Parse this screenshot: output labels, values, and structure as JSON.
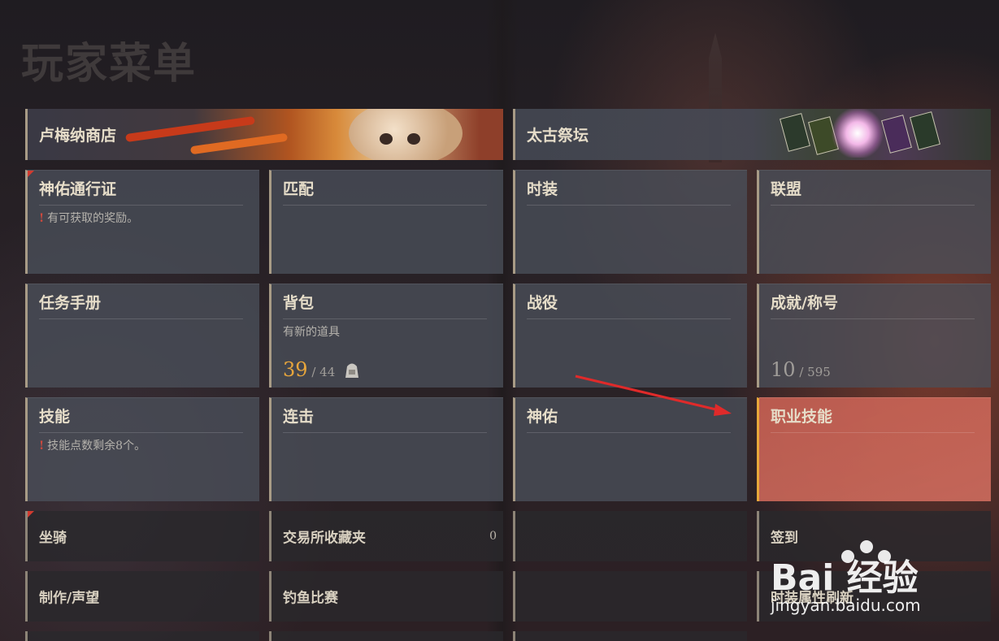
{
  "page_title": "玩家菜单",
  "banners": {
    "lumina_shop": "卢梅纳商店",
    "ancient_altar": "太古祭坛"
  },
  "tiles": {
    "pass": {
      "label": "神佑通行证",
      "note": "有可获取的奖励。"
    },
    "match": {
      "label": "匹配"
    },
    "costume": {
      "label": "时装"
    },
    "alliance": {
      "label": "联盟"
    },
    "quest_book": {
      "label": "任务手册"
    },
    "bag": {
      "label": "背包",
      "note": "有新的道具",
      "used": "39",
      "total": "/ 44"
    },
    "campaign": {
      "label": "战役"
    },
    "achievement": {
      "label": "成就/称号",
      "current": "10",
      "total": "/ 595"
    },
    "skill": {
      "label": "技能",
      "note": "技能点数剩余8个。"
    },
    "combo": {
      "label": "连击"
    },
    "blessing": {
      "label": "神佑"
    },
    "job_skill": {
      "label": "职业技能"
    }
  },
  "list": {
    "mount": "坐骑",
    "trade_fav": "交易所收藏夹",
    "trade_fav_count": "0",
    "checkin": "签到",
    "craft": "制作/声望",
    "fishing": "钓鱼比赛",
    "costume_refresh": "时装属性刷新"
  },
  "watermark": {
    "brand": "Bai 经验",
    "url": "jingyan.baidu.com"
  },
  "colors": {
    "alert": "#d23b30",
    "gold": "#e6a53c",
    "highlight": "#c45f52"
  }
}
